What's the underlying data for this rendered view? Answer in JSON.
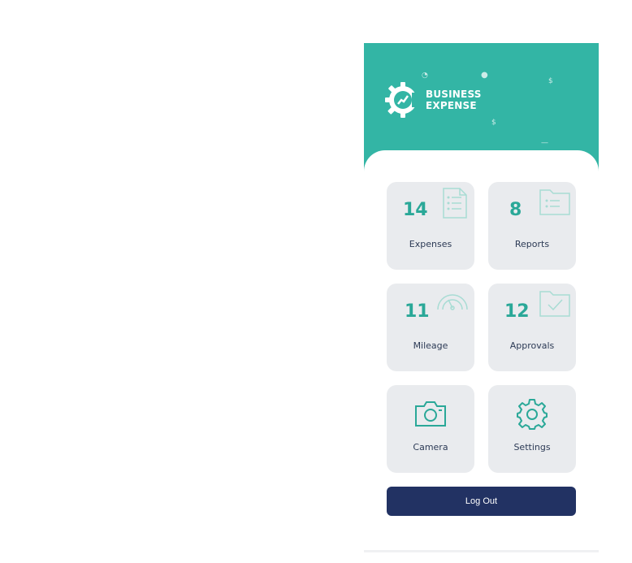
{
  "brand": {
    "line1": "BUSINESS",
    "line2": "EXPENSE",
    "logo_icon": "gear-chart-icon",
    "accent": "#33b5a5"
  },
  "tiles": [
    {
      "key": "expenses",
      "count": "14",
      "label": "Expenses",
      "icon": "document-list-icon"
    },
    {
      "key": "reports",
      "count": "8",
      "label": "Reports",
      "icon": "folder-list-icon"
    },
    {
      "key": "mileage",
      "count": "11",
      "label": "Mileage",
      "icon": "speedometer-icon"
    },
    {
      "key": "approvals",
      "count": "12",
      "label": "Approvals",
      "icon": "folder-check-icon"
    },
    {
      "key": "camera",
      "label": "Camera",
      "icon": "camera-icon"
    },
    {
      "key": "settings",
      "label": "Settings",
      "icon": "gear-icon"
    }
  ],
  "logout": {
    "label": "Log Out",
    "color": "#223263"
  }
}
